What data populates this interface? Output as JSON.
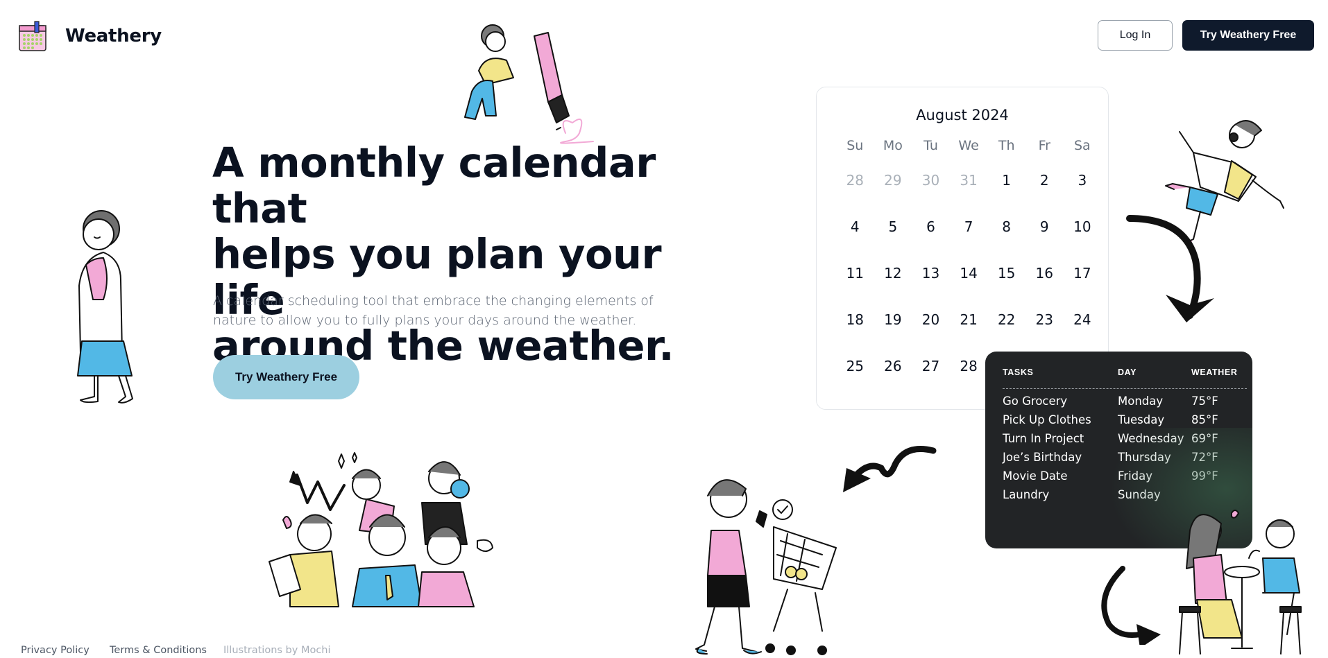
{
  "header": {
    "brand": "Weathery",
    "login_label": "Log In",
    "cta_label": "Try Weathery Free"
  },
  "hero": {
    "title_lines": [
      "A monthly calendar that",
      "helps you plan your life",
      "around the weather."
    ],
    "subtitle_lines": [
      "A calendar scheduling tool that embrace the changing elements of",
      "nature to allow you to fully plans your days around the weather."
    ],
    "cta_label": "Try Weathery Free"
  },
  "calendar": {
    "month_label": "August 2024",
    "weekdays": [
      "Su",
      "Mo",
      "Tu",
      "We",
      "Th",
      "Fr",
      "Sa"
    ],
    "weeks": [
      [
        "28",
        "29",
        "30",
        "31",
        "1",
        "2",
        "3"
      ],
      [
        "4",
        "5",
        "6",
        "7",
        "8",
        "9",
        "10"
      ],
      [
        "11",
        "12",
        "13",
        "14",
        "15",
        "16",
        "17"
      ],
      [
        "18",
        "19",
        "20",
        "21",
        "22",
        "23",
        "24"
      ],
      [
        "25",
        "26",
        "27",
        "28"
      ]
    ],
    "muted_days_first_week": 4
  },
  "tasks": {
    "headers": {
      "task": "TASKS",
      "day": "DAY",
      "weather": "WEATHER"
    },
    "rows": [
      {
        "task": "Go Grocery",
        "day": "Monday",
        "weather": "75°F"
      },
      {
        "task": "Pick Up Clothes",
        "day": "Tuesday",
        "weather": "85°F"
      },
      {
        "task": "Turn In Project",
        "day": "Wednesday",
        "weather": "69°F"
      },
      {
        "task": "Joe’s Birthday",
        "day": "Thursday",
        "weather": "72°F"
      },
      {
        "task": "Movie Date",
        "day": "Friday",
        "weather": "99°F"
      },
      {
        "task": "Laundry",
        "day": "Sunday",
        "weather": ""
      }
    ]
  },
  "footer": {
    "privacy": "Privacy Policy",
    "terms": "Terms & Conditions",
    "credits": "Illustrations by Mochi"
  },
  "colors": {
    "primary_dark": "#0f1a2c",
    "hero_cta_bg": "#9ccfe0",
    "tasks_card_bg": "#222426",
    "illus_pink": "#f2a9d6",
    "illus_yellow": "#f2e58a",
    "illus_blue": "#52b8e6"
  },
  "icons": {
    "logo": "calendar-logo-icon"
  }
}
